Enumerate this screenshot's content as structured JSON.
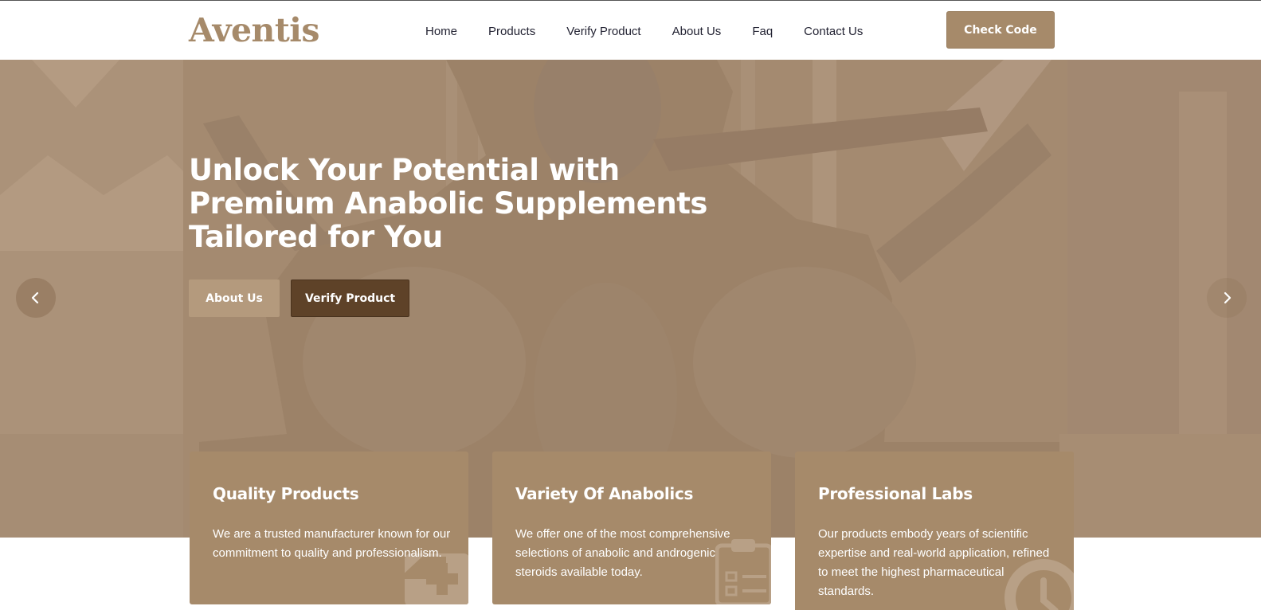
{
  "header": {
    "logo": "Aventis",
    "nav": [
      "Home",
      "Products",
      "Verify Product",
      "About Us",
      "Faq",
      "Contact Us"
    ],
    "cta": "Check Code"
  },
  "hero": {
    "title_lines": [
      "Unlock Your Potential with",
      "Premium Anabolic Supplements",
      "Tailored for You"
    ],
    "buttons": {
      "about": "About Us",
      "verify": "Verify Product"
    },
    "prev_icon": "chevron-left-icon",
    "next_icon": "chevron-right-icon"
  },
  "features": [
    {
      "title": "Quality Products",
      "text": "We are a trusted manufacturer known for our commitment to quality and professionalism.",
      "icon": "medical-kit-icon"
    },
    {
      "title": "Variety Of Anabolics",
      "text": "We offer one of the most comprehensive selections of anabolic and androgenic steroids available today.",
      "icon": "clipboard-checklist-icon"
    },
    {
      "title": "Professional Labs",
      "text": "Our products embody years of scientific expertise and real-world application, refined to meet the highest pharmaceutical standards.",
      "icon": "clock-icon"
    }
  ],
  "colors": {
    "brand": "#a68a6a",
    "dark_button": "#5e4228",
    "hero_overlay": "#a48a70",
    "nav_text": "#232333"
  }
}
